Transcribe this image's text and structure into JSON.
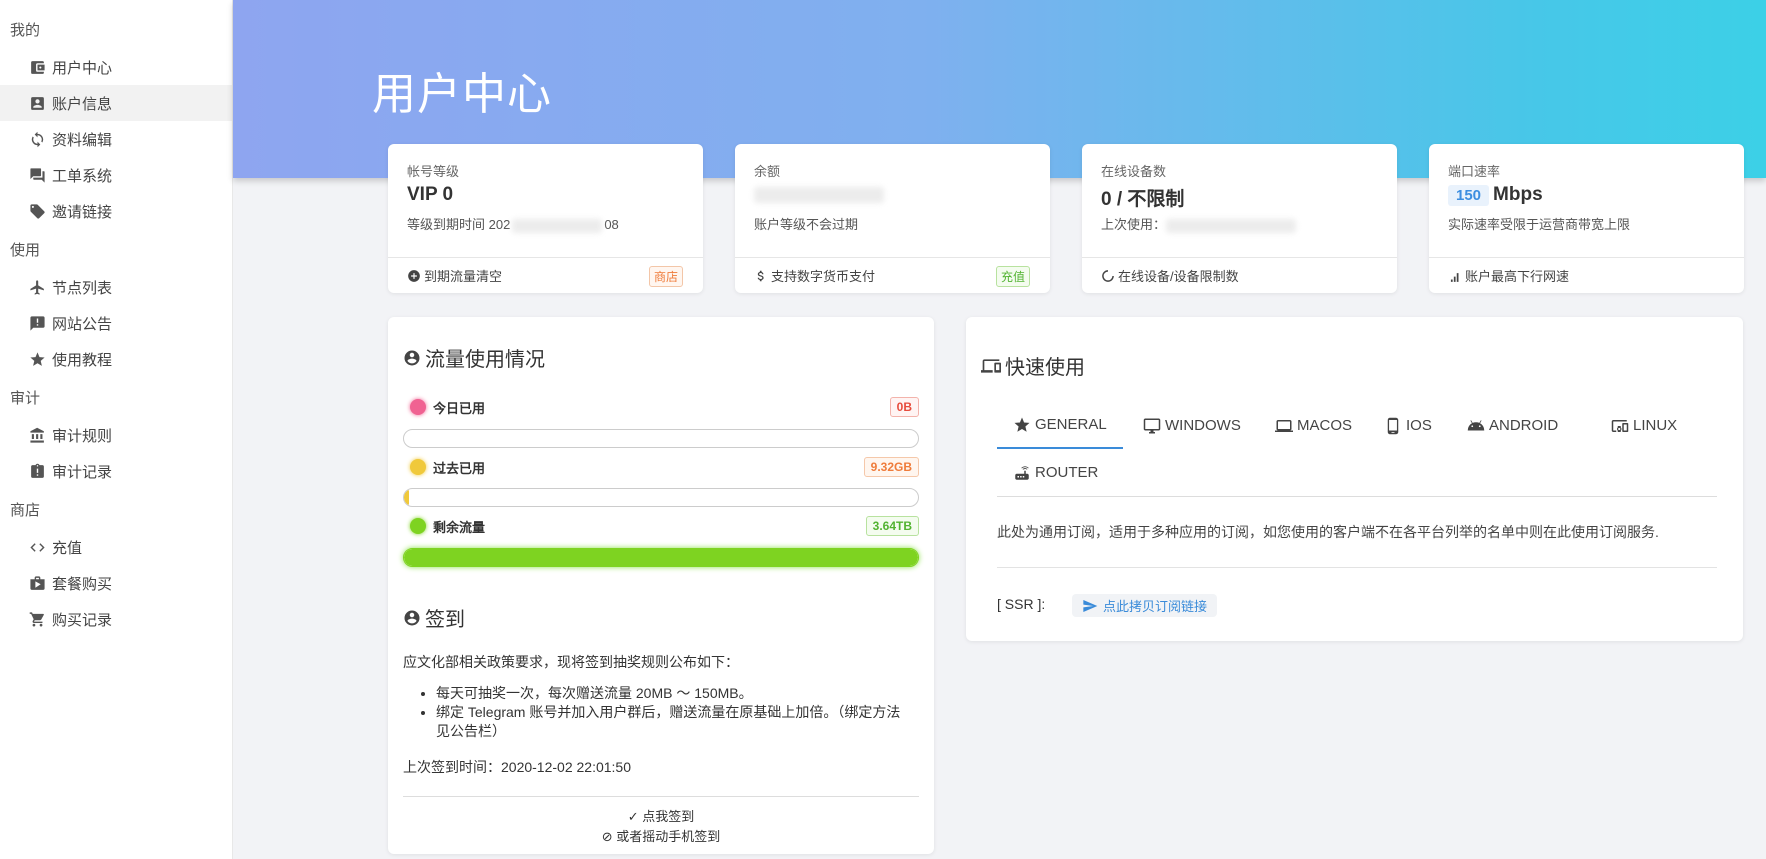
{
  "sidebar": {
    "sections": [
      {
        "title": "我的",
        "items": [
          {
            "label": "用户中心",
            "icon": "wallet-icon"
          },
          {
            "label": "账户信息",
            "icon": "account-box-icon"
          },
          {
            "label": "资料编辑",
            "icon": "sync-icon"
          },
          {
            "label": "工单系统",
            "icon": "forum-icon"
          },
          {
            "label": "邀请链接",
            "icon": "tag-icon"
          }
        ]
      },
      {
        "title": "使用",
        "items": [
          {
            "label": "节点列表",
            "icon": "airplane-icon"
          },
          {
            "label": "网站公告",
            "icon": "announcement-icon"
          },
          {
            "label": "使用教程",
            "icon": "star-icon"
          }
        ]
      },
      {
        "title": "审计",
        "items": [
          {
            "label": "审计规则",
            "icon": "bank-icon"
          },
          {
            "label": "审计记录",
            "icon": "assignment-late-icon"
          }
        ]
      },
      {
        "title": "商店",
        "items": [
          {
            "label": "充值",
            "icon": "code-icon"
          },
          {
            "label": "套餐购买",
            "icon": "shop-icon"
          },
          {
            "label": "购买记录",
            "icon": "cart-icon"
          }
        ]
      }
    ]
  },
  "header": {
    "title": "用户中心"
  },
  "cards": {
    "level": {
      "label": "帐号等级",
      "value": "VIP 0",
      "sub": "等级到期时间 202",
      "sub_tail": "08",
      "footer": "到期流量清空",
      "badge": "商店"
    },
    "balance": {
      "label": "余额",
      "sub": "账户等级不会过期",
      "footer": "支持数字货币支付",
      "badge": "充值"
    },
    "devices": {
      "label": "在线设备数",
      "value": "0 / 不限制",
      "sub": "上次使用：",
      "footer": "在线设备/设备限制数"
    },
    "speed": {
      "label": "端口速率",
      "value_num": "150",
      "value_unit": "Mbps",
      "sub": "实际速率受限于运营商带宽上限",
      "footer": "账户最高下行网速"
    }
  },
  "traffic": {
    "title": "流量使用情况",
    "rows": [
      {
        "label": "今日已用",
        "value": "0B",
        "fraction": 0.0,
        "color": "#f06292"
      },
      {
        "label": "过去已用",
        "value": "9.32GB",
        "fraction": 0.01,
        "color": "#f0c93b"
      },
      {
        "label": "剩余流量",
        "value": "3.64TB",
        "fraction": 1.0,
        "color": "#7ed321"
      }
    ]
  },
  "signin": {
    "title": "签到",
    "intro": "应文化部相关政策要求，现将签到抽奖规则公布如下：",
    "rules": [
      "每天可抽奖一次，每次赠送流量 20MB ～ 150MB。",
      "绑定 Telegram 账号并加入用户群后，赠送流量在原基础上加倍。（绑定方法见公告栏）"
    ],
    "last": "上次签到时间：2020-12-02 22:01:50",
    "button": "点我签到",
    "shake": "或者摇动手机签到"
  },
  "quick": {
    "title": "快速使用",
    "tabs": [
      {
        "label": "GENERAL",
        "icon": "star-icon"
      },
      {
        "label": "WINDOWS",
        "icon": "desktop-icon"
      },
      {
        "label": "MACOS",
        "icon": "laptop-icon"
      },
      {
        "label": "IOS",
        "icon": "phone-icon"
      },
      {
        "label": "ANDROID",
        "icon": "android-icon"
      },
      {
        "label": "LINUX",
        "icon": "devices-icon"
      },
      {
        "label": "ROUTER",
        "icon": "router-icon"
      }
    ],
    "active_tab": "GENERAL",
    "description": "此处为通用订阅，适用于多种应用的订阅，如您使用的客户端不在各平台列举的名单中则在此使用订阅服务.",
    "ssr_label": "[ SSR ]:",
    "copy_button": "点此拷贝订阅链接"
  }
}
